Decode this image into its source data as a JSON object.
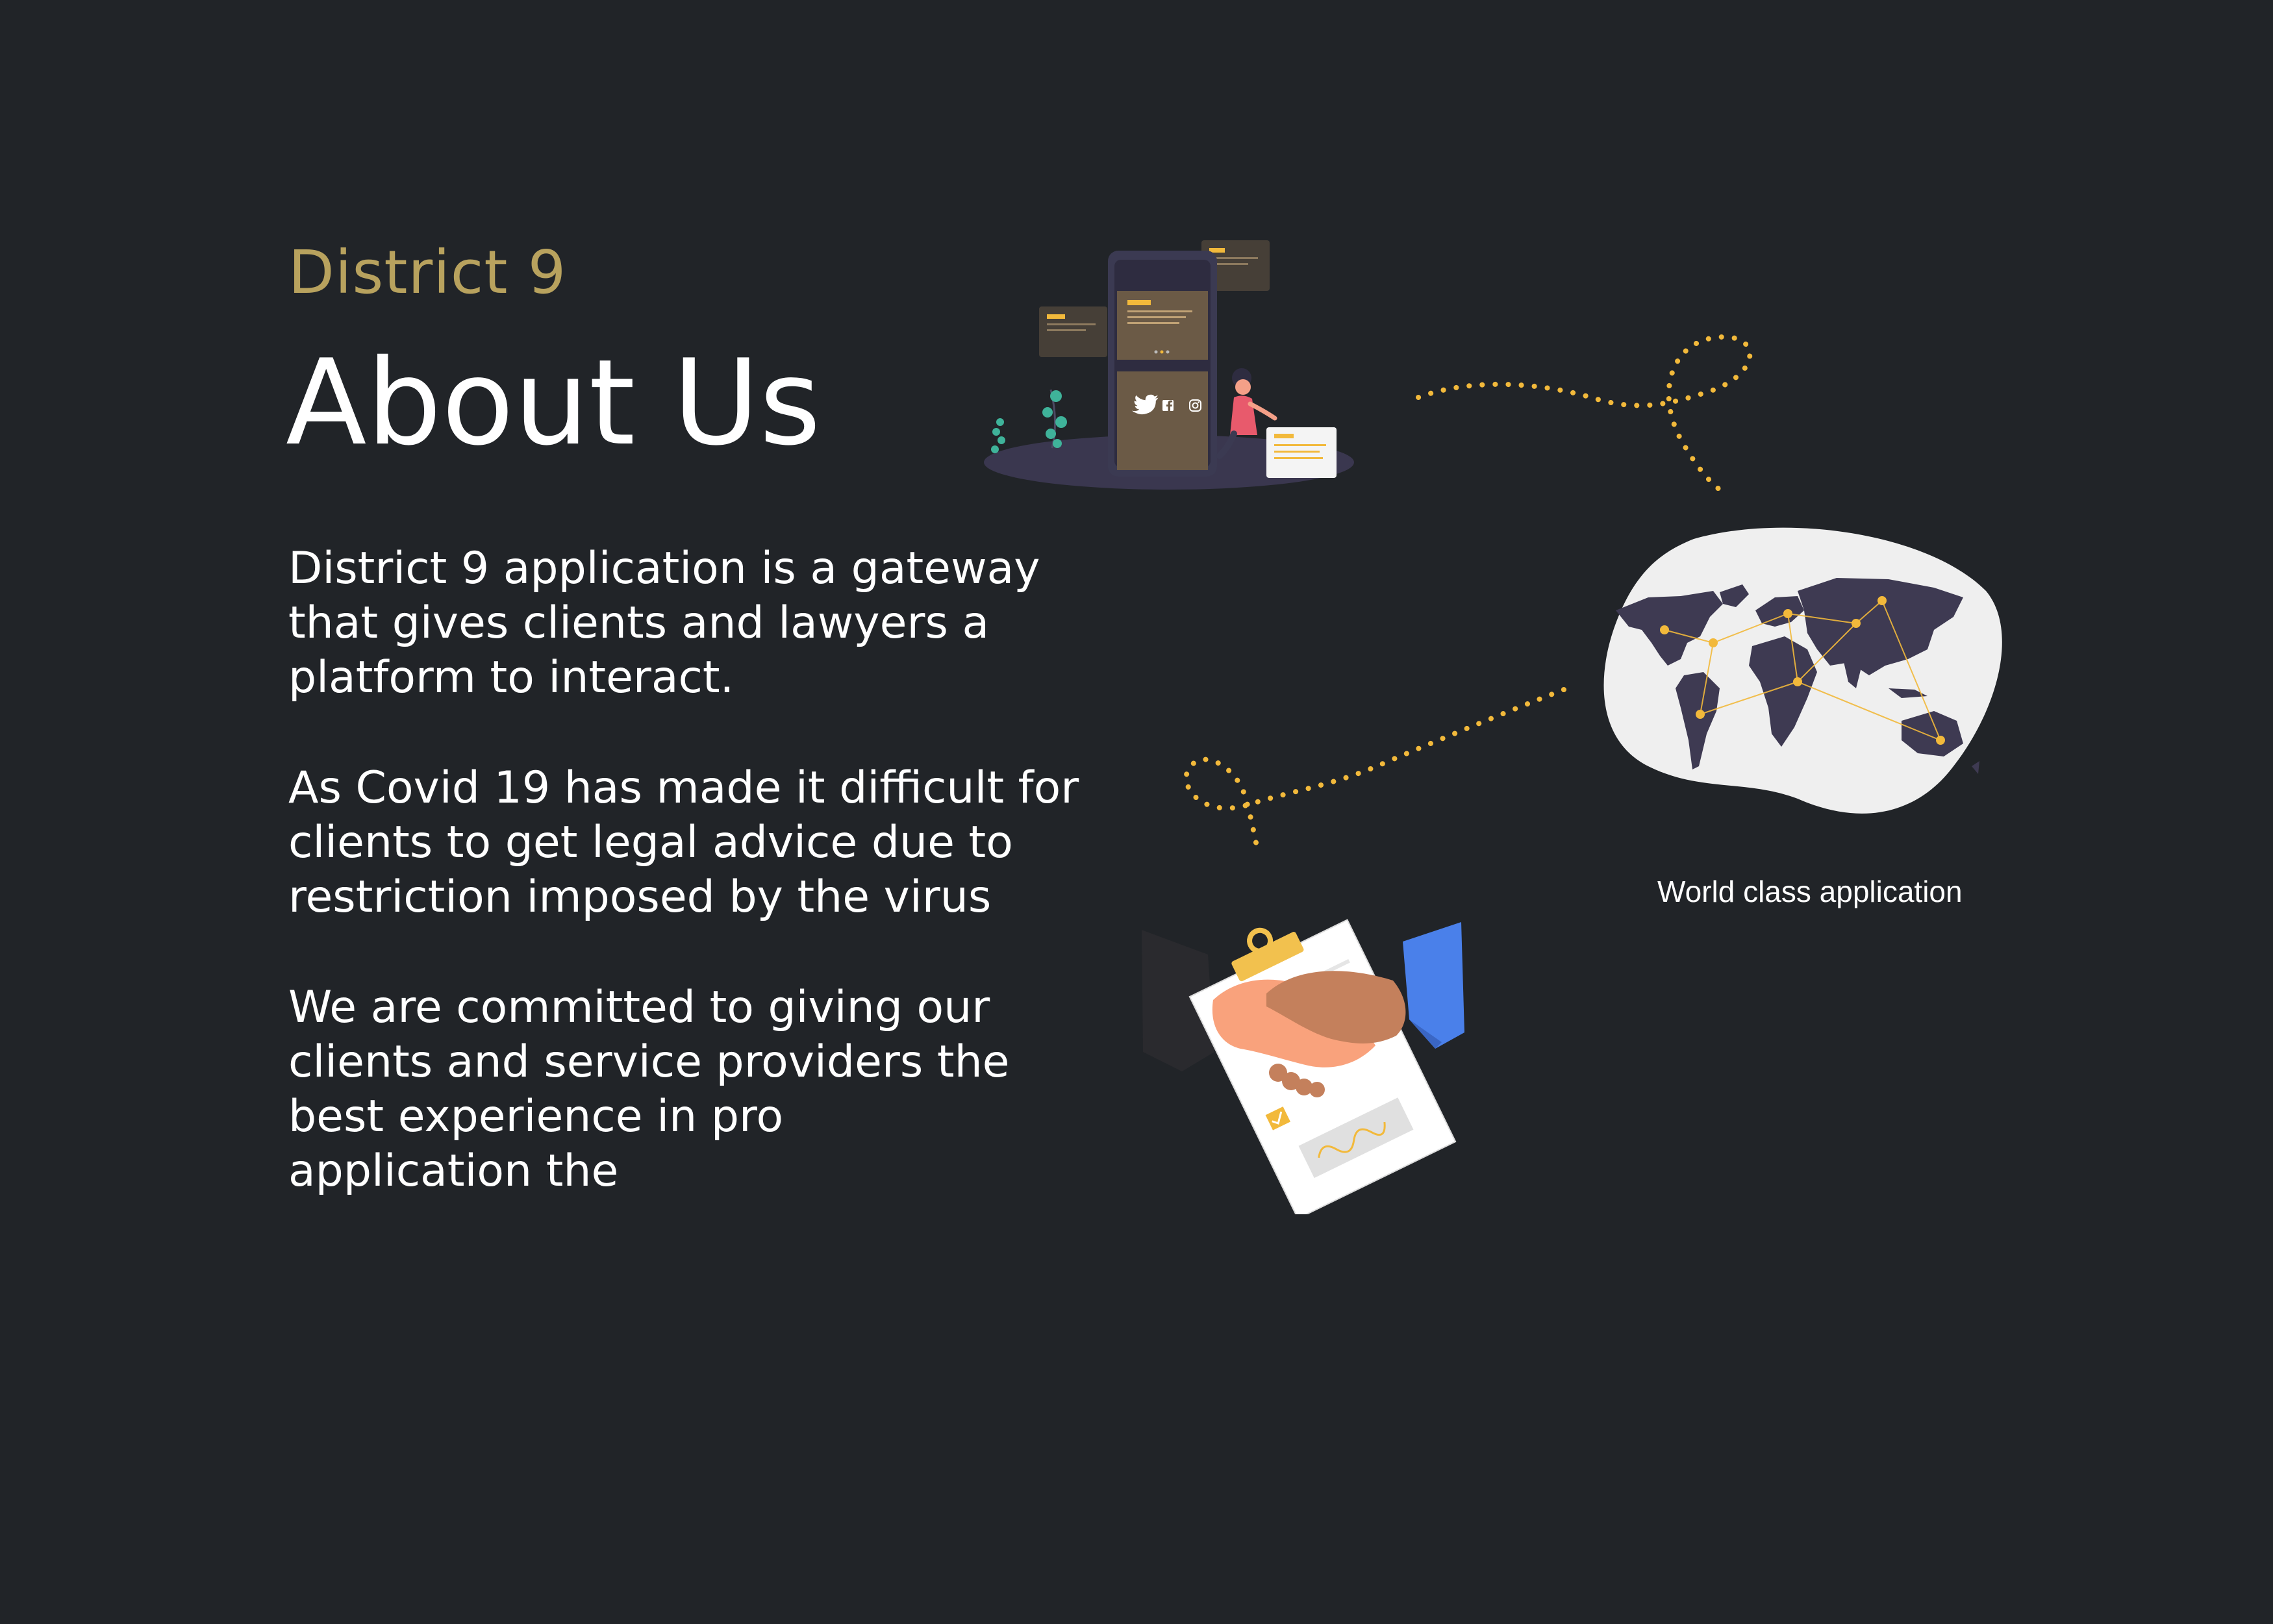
{
  "brand": "District 9",
  "heading": "About Us",
  "paragraphs": [
    "District 9 application is a gateway\nthat gives clients and lawyers a\nplatform to interact.",
    "As Covid 19 has made it difficult for\nclients to get legal advice due to\nrestriction imposed by the virus",
    "We are committed to giving our\nclients and service providers the\nbest experience in pro\napplication  the"
  ],
  "map_caption": "World class application",
  "icons": [
    "phone-illustration",
    "dotted-loop-decoration",
    "world-map-illustration",
    "dotted-loop-decoration",
    "handshake-contract-illustration",
    "twitter-icon",
    "facebook-icon",
    "instagram-icon"
  ],
  "colors": {
    "background": "#212428",
    "brand_accent": "#b8a25e",
    "text": "#ffffff",
    "dots": "#f2b93b",
    "map_land": "#3e3a52",
    "map_blob": "#efefef"
  }
}
